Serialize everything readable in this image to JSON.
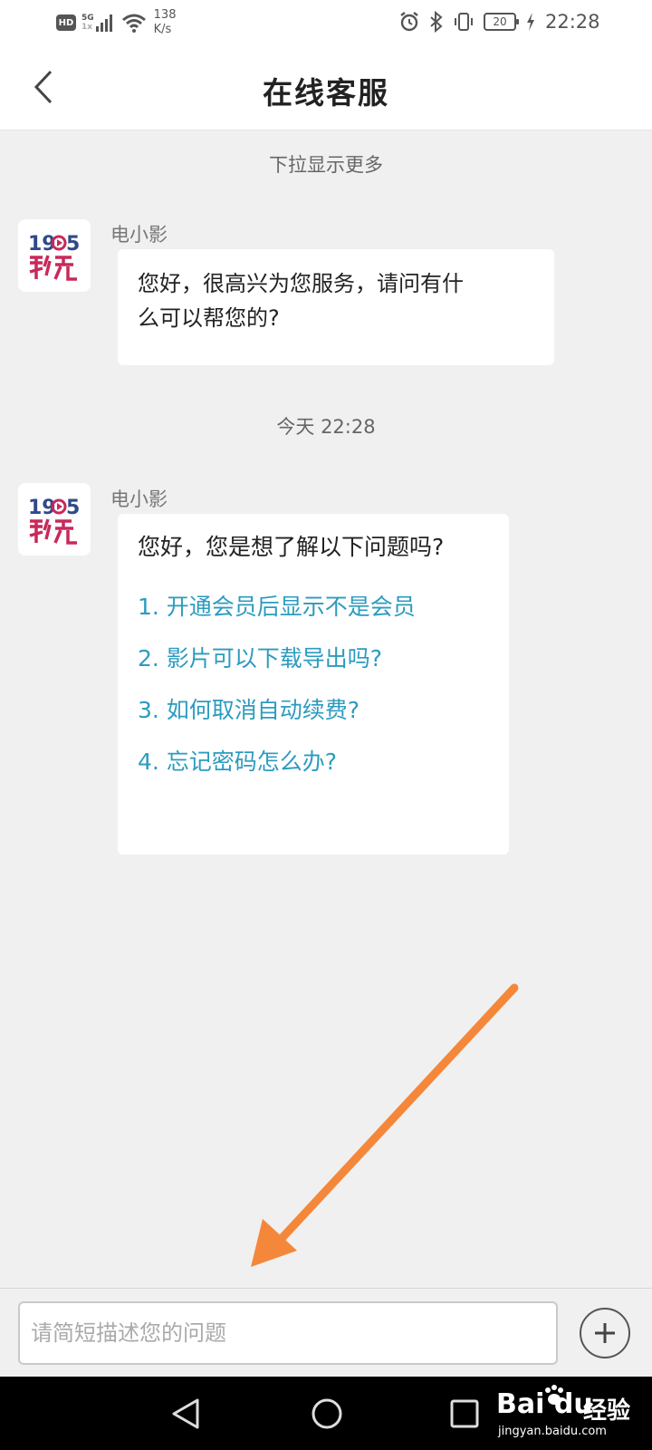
{
  "status_bar": {
    "hd": "HD",
    "network_top": "5G",
    "network_bottom": "1x",
    "speed_value": "138",
    "speed_unit": "K/s",
    "battery": "20",
    "time": "22:28"
  },
  "header": {
    "title": "在线客服"
  },
  "chat": {
    "pull_hint": "下拉显示更多",
    "timestamp": "今天 22:28",
    "messages": [
      {
        "sender": "电小影",
        "avatar": "1905-film-logo",
        "text_line1": "您好，很高兴为您服务，请问有什",
        "text_line2": "么可以帮您的?"
      },
      {
        "sender": "电小影",
        "avatar": "1905-film-logo",
        "intro": "您好，您是想了解以下问题吗?",
        "questions": [
          "1. 开通会员后显示不是会员",
          "2. 影片可以下载导出吗?",
          "3. 如何取消自动续费?",
          "4. 忘记密码怎么办?"
        ]
      }
    ]
  },
  "input_bar": {
    "placeholder": "请简短描述您的问题"
  },
  "watermark": {
    "logo": "Bai du",
    "cn": "经验",
    "url": "jingyan.baidu.com"
  },
  "colors": {
    "link": "#2c9bbf",
    "annotation_arrow": "#f5873a",
    "background": "#f0f0f0"
  }
}
